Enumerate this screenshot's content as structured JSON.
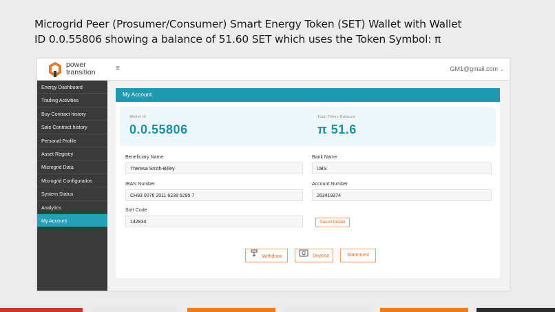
{
  "slide": {
    "title": "Microgrid Peer (Prosumer/Consumer) Smart Energy Token (SET) Wallet with Wallet ID 0.0.55806 showing a balance of 51.60 SET which uses the Token Symbol: π"
  },
  "header": {
    "brand_line1": "power",
    "brand_line2": "transition",
    "menu_icon": "≡",
    "user_email": "GM1@gmail.com",
    "user_chevron": "⌄"
  },
  "sidebar": {
    "items": [
      {
        "label": "Energy Dashboard"
      },
      {
        "label": "Trading Activities"
      },
      {
        "label": "Buy Contract history"
      },
      {
        "label": "Sale Contract history"
      },
      {
        "label": "Personal Profile"
      },
      {
        "label": "Asset Registry"
      },
      {
        "label": "Microgrid Data"
      },
      {
        "label": "Microgrid Configuration"
      },
      {
        "label": "System Status"
      },
      {
        "label": "Analytics"
      },
      {
        "label": "My Account"
      }
    ],
    "active_index": 10
  },
  "account": {
    "title": "My Account",
    "wallet_label": "Wallet Id",
    "wallet_id": "0.0.55806",
    "balance_label": "Total Token Balance",
    "balance_value": "π 51.6"
  },
  "form": {
    "beneficiary_label": "Beneficiary Name",
    "beneficiary_value": "Theresa Smith-Billey",
    "bank_label": "Bank Name",
    "bank_value": "UBS",
    "iban_label": "IBAN Number",
    "iban_value": "CH93 0076 2011 6238 5295 7",
    "account_label": "Account Number",
    "account_value": "263419374",
    "sort_label": "Sort Code",
    "sort_value": "142834",
    "save_label": "Save/Update"
  },
  "actions": {
    "withdraw_label": "Withdraw",
    "deposit_label": "Deposit",
    "statement_label": "Statement"
  },
  "colors": {
    "accent": "#1e9aae",
    "sidebar_bg": "#3a3a3a",
    "button_orange": "#e06a2a",
    "footer": [
      "#c0392b",
      "#e8e8e8",
      "#e67e22",
      "#e8e8e8",
      "#e67e22",
      "#e8e8e8",
      "#2c2c2c"
    ]
  }
}
